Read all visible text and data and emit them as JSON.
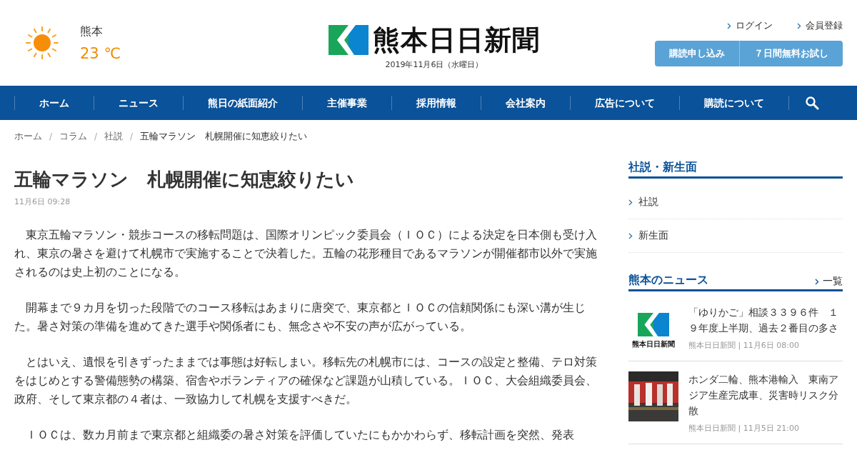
{
  "weather": {
    "city": "熊本",
    "temperature": "23 ℃"
  },
  "logo": {
    "text": "熊本日日新聞"
  },
  "date": "2019年11月6日（水曜日）",
  "account_links": [
    "ログイン",
    "会員登録"
  ],
  "subscribe_buttons": [
    "購読申し込み",
    "７日間無料お試し"
  ],
  "nav": {
    "items": [
      "ホーム",
      "ニュース",
      "熊日の紙面紹介",
      "主催事業",
      "採用情報",
      "会社案内",
      "広告について",
      "購読について"
    ]
  },
  "breadcrumb_separator": "/",
  "breadcrumb": [
    "ホーム",
    "コラム",
    "社説",
    "五輪マラソン　札幌開催に知恵絞りたい"
  ],
  "article": {
    "title": "五輪マラソン　札幌開催に知恵絞りたい",
    "time": "11月6日 09:28",
    "paragraphs": [
      "　東京五輪マラソン・競歩コースの移転問題は、国際オリンピック委員会（ＩＯＣ）による決定を日本側も受け入れ、東京の暑さを避けて札幌市で実施することで決着した。五輪の花形種目であるマラソンが開催都市以外で実施されるのは史上初のことになる。",
      "　開幕まで９カ月を切った段階でのコース移転はあまりに唐突で、東京都とＩＯＣの信頼関係にも深い溝が生じた。暑さ対策の準備を進めてきた選手や関係者にも、無念さや不安の声が広がっている。",
      "　とはいえ、遺恨を引きずったままでは事態は好転しまい。移転先の札幌市には、コースの設定と整備、テロ対策をはじめとする警備態勢の構築、宿舎やボランティアの確保など課題が山積している。ＩＯＣ、大会組織委員会、政府、そして東京都の４者は、一致協力して札幌を支援すべきだ。",
      "　ＩＯＣは、数カ月前まで東京都と組織委の暑さ対策を評価していたにもかかわらず、移転計画を突然、発表"
    ]
  },
  "sidebar": {
    "editorial": {
      "title": "社説・新生面",
      "items": [
        "社説",
        "新生面"
      ]
    },
    "local_news": {
      "title": "熊本のニュース",
      "more_link": "一覧",
      "items": [
        {
          "title": "「ゆりかご」相談３３９６件　１９年度上半期、過去２番目の多さ",
          "meta": "熊本日日新聞 | 11月6日 08:00",
          "thumbnail": {
            "kind": "logo",
            "text": "熊本日日新聞"
          }
        },
        {
          "title": "ホンダ二輪、熊本港輸入　東南アジア生産完成車、災害時リスク分散",
          "meta": "熊本日日新聞 | 11月5日 21:00"
        }
      ]
    }
  }
}
